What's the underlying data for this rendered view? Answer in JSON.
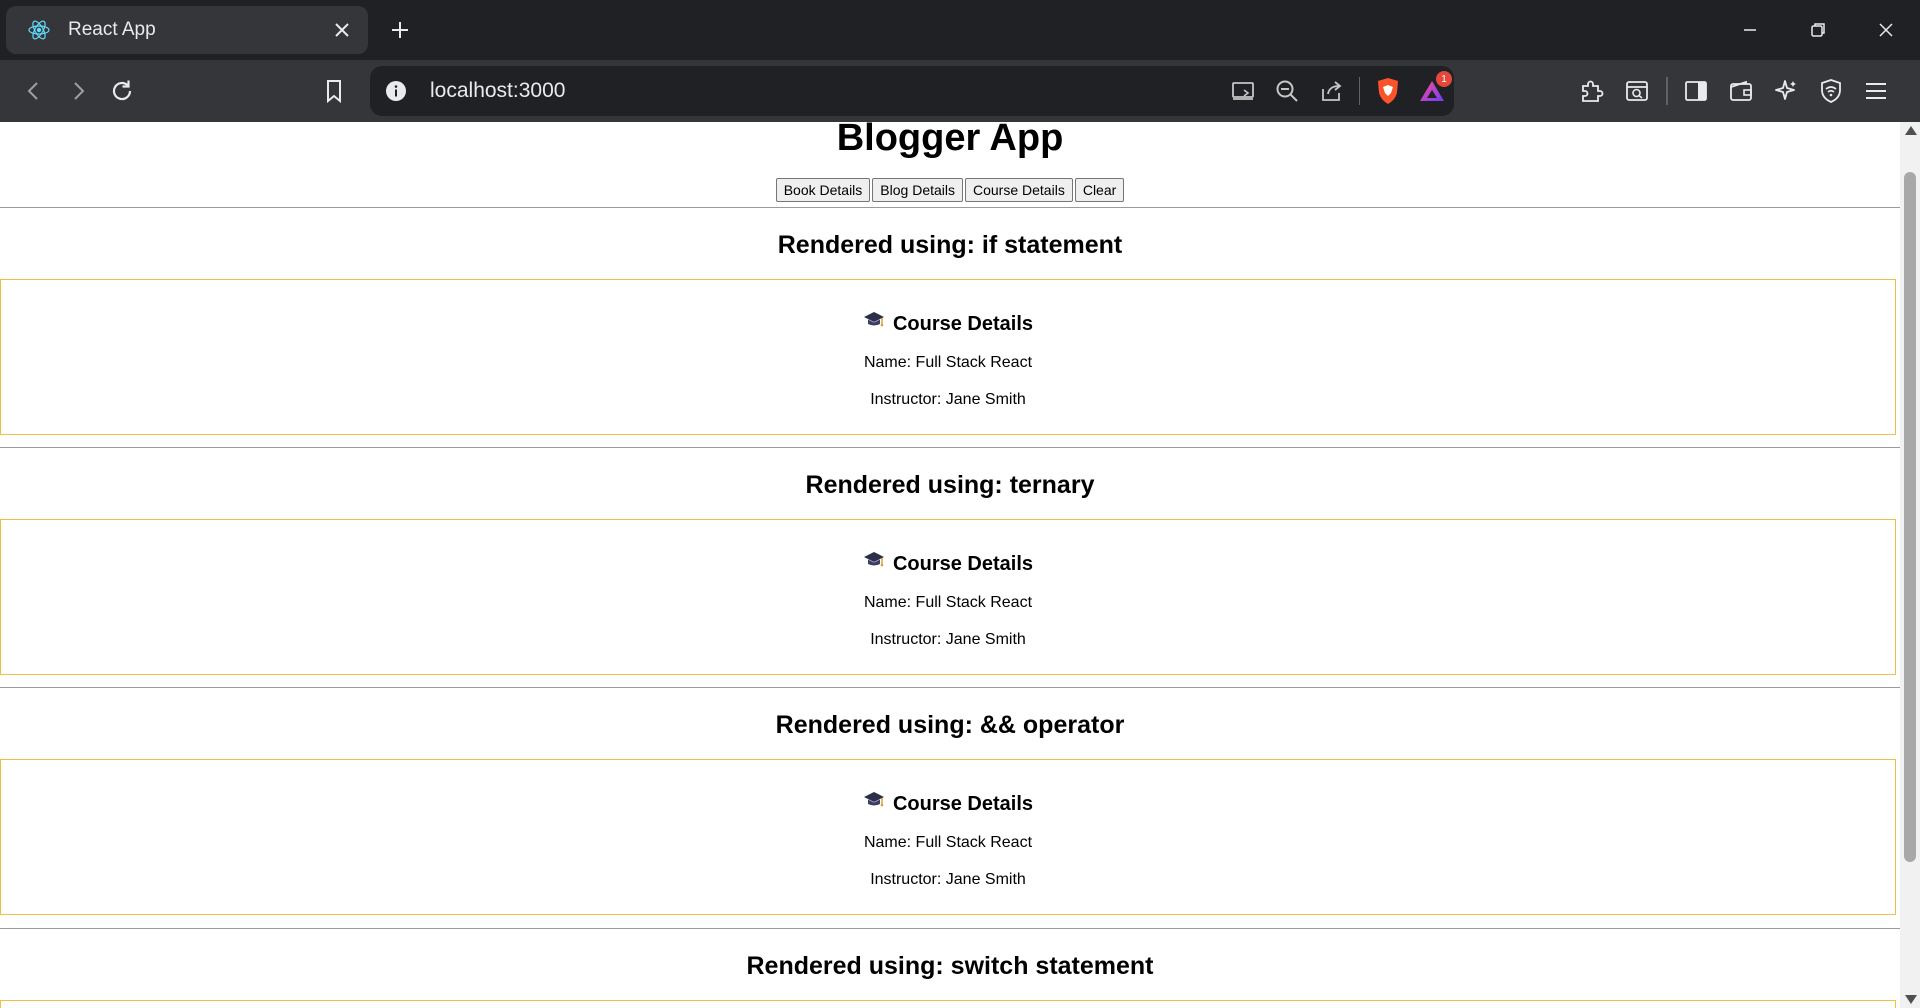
{
  "browser": {
    "tab_title": "React App",
    "url": "localhost:3000",
    "notification_count": "1"
  },
  "page": {
    "title": "Blogger App",
    "buttons": [
      "Book Details",
      "Blog Details",
      "Course Details",
      "Clear"
    ],
    "sections": [
      {
        "heading": "Rendered using: if statement",
        "card": {
          "icon": "graduation-cap-icon",
          "title": "Course Details",
          "name": "Name: Full Stack React",
          "instructor": "Instructor: Jane Smith"
        }
      },
      {
        "heading": "Rendered using: ternary",
        "card": {
          "icon": "graduation-cap-icon",
          "title": "Course Details",
          "name": "Name: Full Stack React",
          "instructor": "Instructor: Jane Smith"
        }
      },
      {
        "heading": "Rendered using: && operator",
        "card": {
          "icon": "graduation-cap-icon",
          "title": "Course Details",
          "name": "Name: Full Stack React",
          "instructor": "Instructor: Jane Smith"
        }
      },
      {
        "heading": "Rendered using: switch statement",
        "card": null
      }
    ]
  },
  "colors": {
    "card_border": "#f0c040",
    "chrome_dark": "#202124",
    "chrome_mid": "#35363a",
    "brave_orange": "#fb542b"
  }
}
